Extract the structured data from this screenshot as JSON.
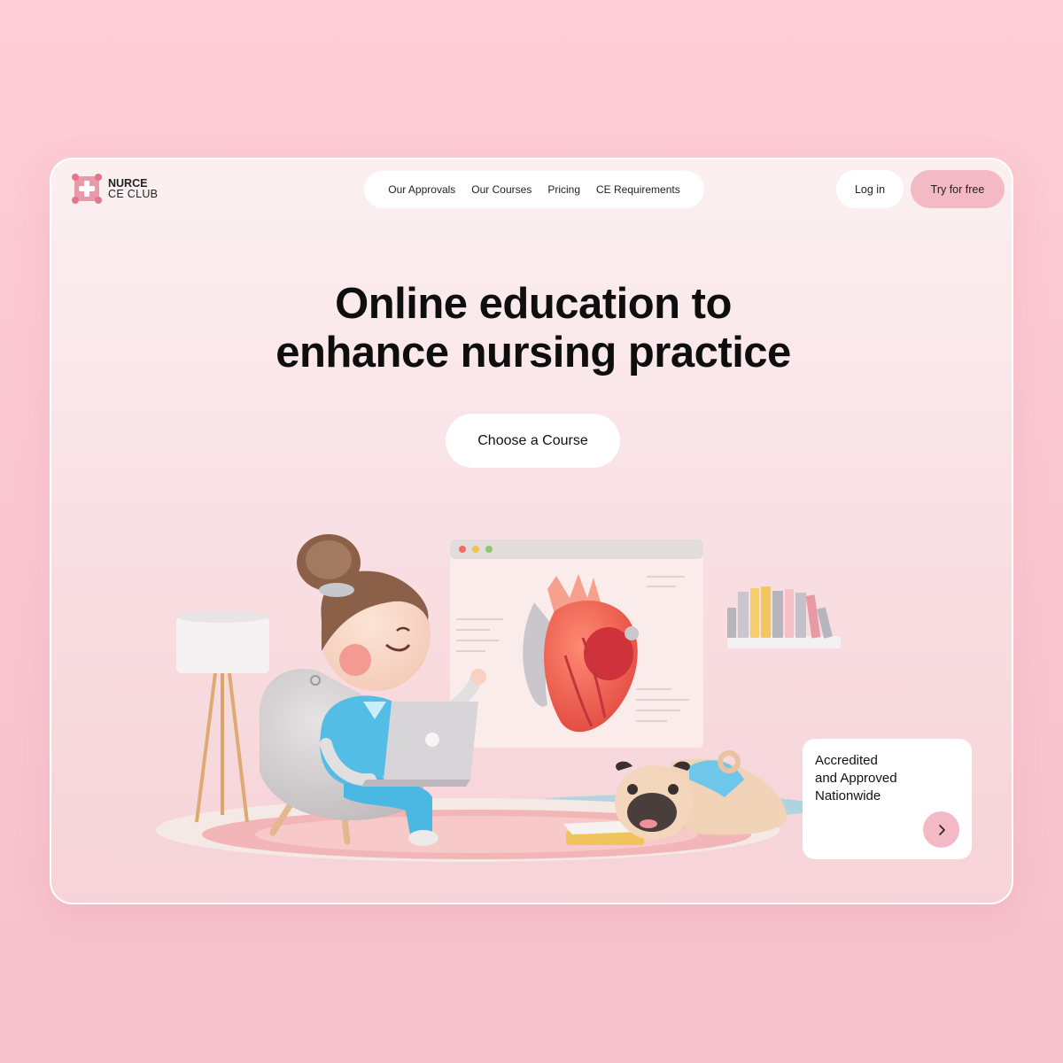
{
  "brand": {
    "line1": "NURCE",
    "line2": "CE CLUB"
  },
  "nav": [
    {
      "label": "Our Approvals"
    },
    {
      "label": "Our Courses"
    },
    {
      "label": "Pricing"
    },
    {
      "label": "CE Requirements"
    }
  ],
  "auth": {
    "login_label": "Log in",
    "try_label": "Try for free"
  },
  "hero": {
    "title_line1": "Online education to",
    "title_line2": "enhance nursing practice",
    "cta_label": "Choose a Course"
  },
  "info_card": {
    "lines": [
      "Accredited",
      "and Approved",
      "Nationwide"
    ],
    "arrow_icon": "chevron-right-icon"
  },
  "colors": {
    "page_bg": "#fecdd5",
    "accent": "#f3b9c4",
    "heart": "#ee5b4e"
  },
  "icons": {
    "logo": "medical-cross-logo-icon",
    "illustration": "nurse-laptop-heart-illustration"
  }
}
